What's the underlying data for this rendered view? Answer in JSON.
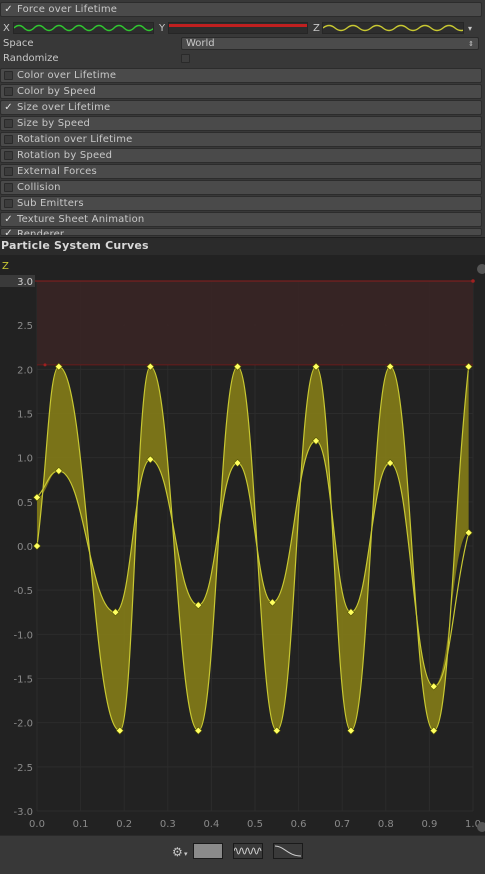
{
  "modules": {
    "force": {
      "label": "Force over Lifetime",
      "enabled": true
    },
    "list": [
      {
        "label": "Color over Lifetime",
        "enabled": false
      },
      {
        "label": "Color by Speed",
        "enabled": false
      },
      {
        "label": "Size over Lifetime",
        "enabled": true
      },
      {
        "label": "Size by Speed",
        "enabled": false
      },
      {
        "label": "Rotation over Lifetime",
        "enabled": false
      },
      {
        "label": "Rotation by Speed",
        "enabled": false
      },
      {
        "label": "External Forces",
        "enabled": false
      },
      {
        "label": "Collision",
        "enabled": false
      },
      {
        "label": "Sub Emitters",
        "enabled": false
      },
      {
        "label": "Texture Sheet Animation",
        "enabled": true
      },
      {
        "label": "Renderer",
        "enabled": true
      }
    ]
  },
  "force": {
    "x_label": "X",
    "y_label": "Y",
    "z_label": "Z",
    "space_label": "Space",
    "space_value": "World",
    "randomize_label": "Randomize"
  },
  "curves_window": {
    "title": "Particle System Curves",
    "curve_label": "Z"
  },
  "colors": {
    "accent": "#c8c832",
    "fill": "#807818",
    "highlight_band": "#3a2424",
    "y_curve": "#c02020",
    "x_curve": "#30c830"
  },
  "chart_data": {
    "type": "area",
    "title": "",
    "xlabel": "",
    "ylabel": "",
    "xlim": [
      0,
      1
    ],
    "ylim": [
      -3,
      3
    ],
    "x_ticks": [
      "0.0",
      "0.1",
      "0.2",
      "0.3",
      "0.4",
      "0.5",
      "0.6",
      "0.7",
      "0.8",
      "0.9",
      "1.0"
    ],
    "y_ticks": [
      "3.0",
      "2.5",
      "2.0",
      "1.5",
      "1.0",
      "0.5",
      "0.0",
      "-0.5",
      "-1.0",
      "-1.5",
      "-2.0",
      "-2.5",
      "-3.0"
    ],
    "highlight_range": [
      2.05,
      3.0
    ],
    "series": [
      {
        "x": [
          0.0,
          0.05,
          0.18,
          0.26,
          0.37,
          0.46,
          0.54,
          0.64,
          0.72,
          0.81,
          0.91,
          0.99
        ],
        "values": [
          0.55,
          0.85,
          -0.75,
          0.98,
          -0.67,
          0.94,
          -0.64,
          1.19,
          -0.75,
          0.94,
          -1.59,
          0.15
        ]
      },
      {
        "x": [
          0.0,
          0.05,
          0.19,
          0.26,
          0.37,
          0.46,
          0.55,
          0.64,
          0.72,
          0.81,
          0.91,
          0.99
        ],
        "values": [
          0.0,
          2.03,
          -2.09,
          2.03,
          -2.09,
          2.03,
          -2.09,
          2.03,
          -2.09,
          2.03,
          -2.09,
          2.03
        ]
      }
    ]
  }
}
